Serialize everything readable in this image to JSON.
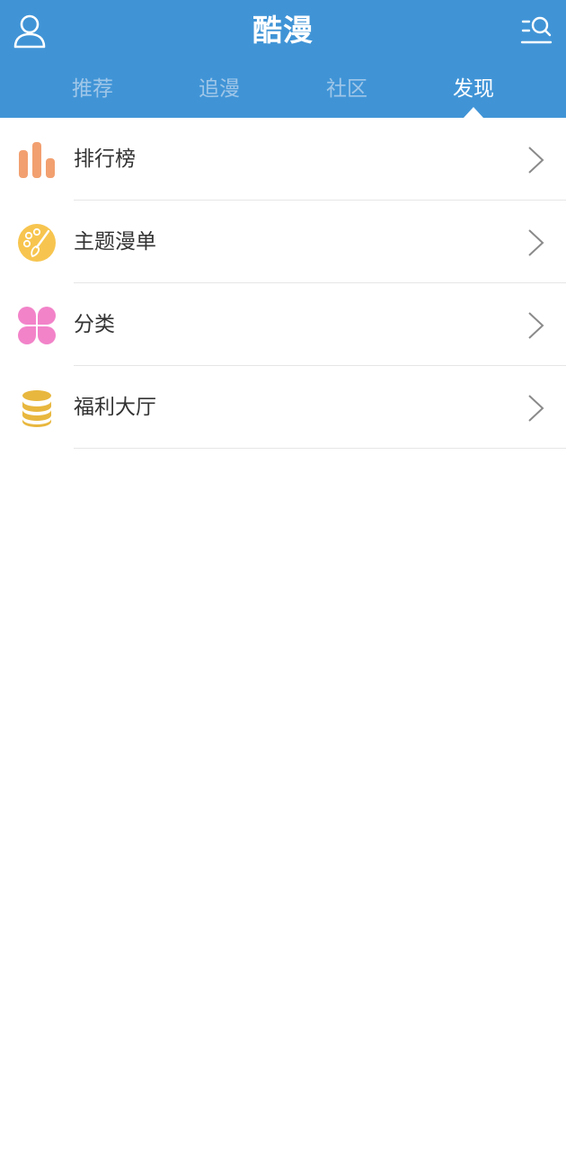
{
  "header": {
    "title": "酷漫",
    "background_color": "#4094d6",
    "left_icon": "user-profile-icon",
    "right_icon": "search-list-icon"
  },
  "tabs": [
    {
      "label": "推荐",
      "active": false
    },
    {
      "label": "追漫",
      "active": false
    },
    {
      "label": "社区",
      "active": false
    },
    {
      "label": "发现",
      "active": true
    }
  ],
  "menu": {
    "items": [
      {
        "label": "排行榜",
        "icon": "ranking-bar-chart-icon",
        "icon_color": "#f2a070"
      },
      {
        "label": "主题漫单",
        "icon": "theme-palette-icon",
        "icon_color": "#f7c54f"
      },
      {
        "label": "分类",
        "icon": "category-clover-icon",
        "icon_color": "#f283c9"
      },
      {
        "label": "福利大厅",
        "icon": "welfare-coins-icon",
        "icon_color": "#e8b73e"
      }
    ],
    "chevron_icon": "chevron-right-icon"
  }
}
